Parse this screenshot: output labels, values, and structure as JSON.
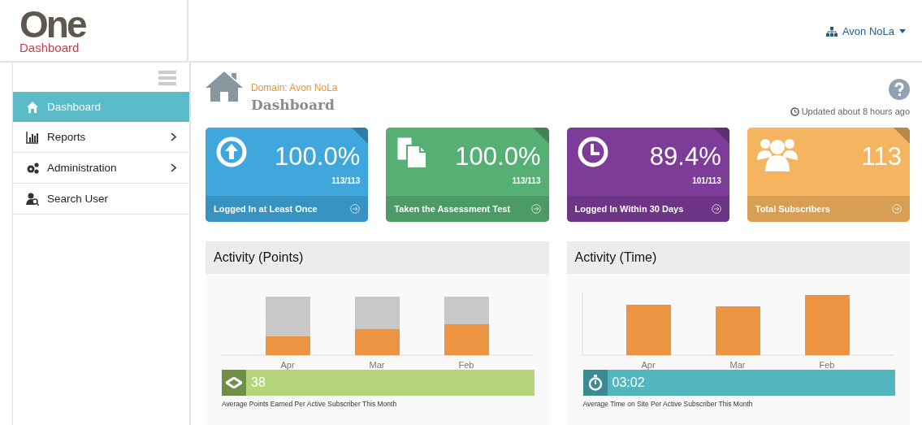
{
  "logo": {
    "mark": "One",
    "subtitle": "Dashboard"
  },
  "user_menu": {
    "label": "Avon NoLa"
  },
  "sidebar": {
    "items": [
      {
        "label": "Dashboard",
        "kind": "home",
        "selected": true,
        "has_submenu": false
      },
      {
        "label": "Reports",
        "kind": "chart",
        "selected": false,
        "has_submenu": true
      },
      {
        "label": "Administration",
        "kind": "gears",
        "selected": false,
        "has_submenu": true
      },
      {
        "label": "Search User",
        "kind": "user",
        "selected": false,
        "has_submenu": false
      }
    ]
  },
  "page": {
    "domain": "Domain: Avon NoLa",
    "title": "Dashboard",
    "updated": "Updated about 8 hours ago"
  },
  "cards": [
    {
      "kind": "upload",
      "value": "100.0%",
      "sub": "113/113",
      "label": "Logged In at Least Once",
      "color": "#3fa7dc"
    },
    {
      "kind": "docs",
      "value": "100.0%",
      "sub": "113/113",
      "label": "Taken the Assessment Test",
      "color": "#56b074"
    },
    {
      "kind": "clock",
      "value": "89.4%",
      "sub": "101/113",
      "label": "Logged In Within 30 Days",
      "color": "#7d3c98"
    },
    {
      "kind": "group",
      "value": "113",
      "label": "Total Subscribers",
      "color": "#f5b460"
    }
  ],
  "panels": [
    {
      "title": "Activity (Points)",
      "kind": "points",
      "months": [
        "Apr",
        "Mar",
        "Feb"
      ],
      "stat": "38",
      "caption": "Average Points Earned Per Active Subscriber This Month"
    },
    {
      "title": "Activity (Time)",
      "kind": "time",
      "months": [
        "Apr",
        "Mar",
        "Feb"
      ],
      "stat": "03:02",
      "caption": "Average Time on Site Per Active Subscriber This Month"
    }
  ]
}
